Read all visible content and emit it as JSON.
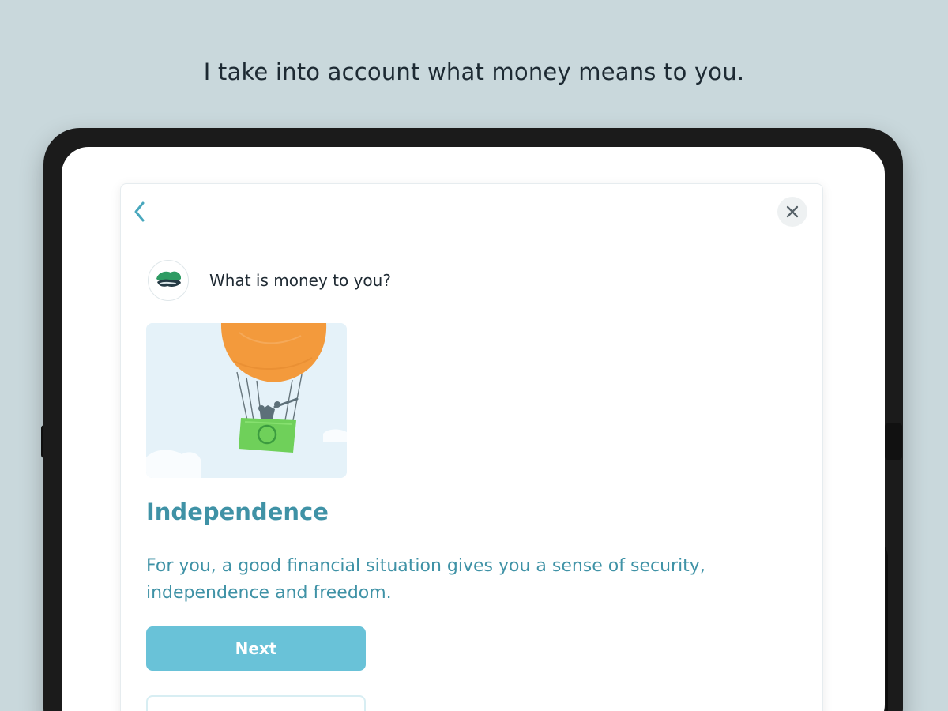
{
  "headline": "I take into account what money means to you.",
  "card": {
    "question": "What is money to you?",
    "title": "Independence",
    "description": "For you, a good financial situation gives you a sense of security, independence and freedom.",
    "next_label": "Next"
  },
  "icons": {
    "back": "chevron-left-icon",
    "close": "close-icon",
    "avatar": "money-cloud-icon",
    "illustration": "hot-air-balloon-illustration"
  },
  "colors": {
    "background": "#c9d8dc",
    "accent": "#3f92a6",
    "button": "#69c2d8",
    "text": "#1d2a33"
  }
}
